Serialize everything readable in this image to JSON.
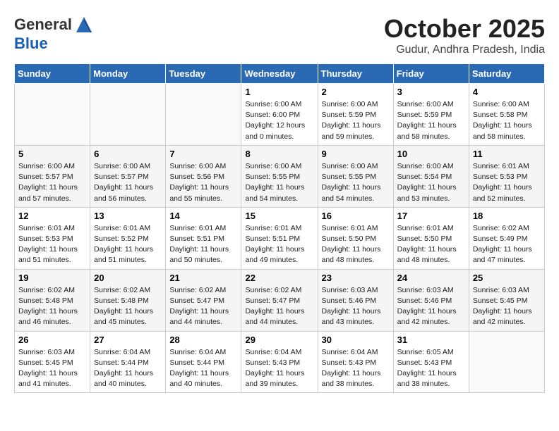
{
  "header": {
    "logo_line1": "General",
    "logo_line2": "Blue",
    "month": "October 2025",
    "location": "Gudur, Andhra Pradesh, India"
  },
  "weekdays": [
    "Sunday",
    "Monday",
    "Tuesday",
    "Wednesday",
    "Thursday",
    "Friday",
    "Saturday"
  ],
  "weeks": [
    [
      {
        "day": "",
        "info": ""
      },
      {
        "day": "",
        "info": ""
      },
      {
        "day": "",
        "info": ""
      },
      {
        "day": "1",
        "info": "Sunrise: 6:00 AM\nSunset: 6:00 PM\nDaylight: 12 hours\nand 0 minutes."
      },
      {
        "day": "2",
        "info": "Sunrise: 6:00 AM\nSunset: 5:59 PM\nDaylight: 11 hours\nand 59 minutes."
      },
      {
        "day": "3",
        "info": "Sunrise: 6:00 AM\nSunset: 5:59 PM\nDaylight: 11 hours\nand 58 minutes."
      },
      {
        "day": "4",
        "info": "Sunrise: 6:00 AM\nSunset: 5:58 PM\nDaylight: 11 hours\nand 58 minutes."
      }
    ],
    [
      {
        "day": "5",
        "info": "Sunrise: 6:00 AM\nSunset: 5:57 PM\nDaylight: 11 hours\nand 57 minutes."
      },
      {
        "day": "6",
        "info": "Sunrise: 6:00 AM\nSunset: 5:57 PM\nDaylight: 11 hours\nand 56 minutes."
      },
      {
        "day": "7",
        "info": "Sunrise: 6:00 AM\nSunset: 5:56 PM\nDaylight: 11 hours\nand 55 minutes."
      },
      {
        "day": "8",
        "info": "Sunrise: 6:00 AM\nSunset: 5:55 PM\nDaylight: 11 hours\nand 54 minutes."
      },
      {
        "day": "9",
        "info": "Sunrise: 6:00 AM\nSunset: 5:55 PM\nDaylight: 11 hours\nand 54 minutes."
      },
      {
        "day": "10",
        "info": "Sunrise: 6:00 AM\nSunset: 5:54 PM\nDaylight: 11 hours\nand 53 minutes."
      },
      {
        "day": "11",
        "info": "Sunrise: 6:01 AM\nSunset: 5:53 PM\nDaylight: 11 hours\nand 52 minutes."
      }
    ],
    [
      {
        "day": "12",
        "info": "Sunrise: 6:01 AM\nSunset: 5:53 PM\nDaylight: 11 hours\nand 51 minutes."
      },
      {
        "day": "13",
        "info": "Sunrise: 6:01 AM\nSunset: 5:52 PM\nDaylight: 11 hours\nand 51 minutes."
      },
      {
        "day": "14",
        "info": "Sunrise: 6:01 AM\nSunset: 5:51 PM\nDaylight: 11 hours\nand 50 minutes."
      },
      {
        "day": "15",
        "info": "Sunrise: 6:01 AM\nSunset: 5:51 PM\nDaylight: 11 hours\nand 49 minutes."
      },
      {
        "day": "16",
        "info": "Sunrise: 6:01 AM\nSunset: 5:50 PM\nDaylight: 11 hours\nand 48 minutes."
      },
      {
        "day": "17",
        "info": "Sunrise: 6:01 AM\nSunset: 5:50 PM\nDaylight: 11 hours\nand 48 minutes."
      },
      {
        "day": "18",
        "info": "Sunrise: 6:02 AM\nSunset: 5:49 PM\nDaylight: 11 hours\nand 47 minutes."
      }
    ],
    [
      {
        "day": "19",
        "info": "Sunrise: 6:02 AM\nSunset: 5:48 PM\nDaylight: 11 hours\nand 46 minutes."
      },
      {
        "day": "20",
        "info": "Sunrise: 6:02 AM\nSunset: 5:48 PM\nDaylight: 11 hours\nand 45 minutes."
      },
      {
        "day": "21",
        "info": "Sunrise: 6:02 AM\nSunset: 5:47 PM\nDaylight: 11 hours\nand 44 minutes."
      },
      {
        "day": "22",
        "info": "Sunrise: 6:02 AM\nSunset: 5:47 PM\nDaylight: 11 hours\nand 44 minutes."
      },
      {
        "day": "23",
        "info": "Sunrise: 6:03 AM\nSunset: 5:46 PM\nDaylight: 11 hours\nand 43 minutes."
      },
      {
        "day": "24",
        "info": "Sunrise: 6:03 AM\nSunset: 5:46 PM\nDaylight: 11 hours\nand 42 minutes."
      },
      {
        "day": "25",
        "info": "Sunrise: 6:03 AM\nSunset: 5:45 PM\nDaylight: 11 hours\nand 42 minutes."
      }
    ],
    [
      {
        "day": "26",
        "info": "Sunrise: 6:03 AM\nSunset: 5:45 PM\nDaylight: 11 hours\nand 41 minutes."
      },
      {
        "day": "27",
        "info": "Sunrise: 6:04 AM\nSunset: 5:44 PM\nDaylight: 11 hours\nand 40 minutes."
      },
      {
        "day": "28",
        "info": "Sunrise: 6:04 AM\nSunset: 5:44 PM\nDaylight: 11 hours\nand 40 minutes."
      },
      {
        "day": "29",
        "info": "Sunrise: 6:04 AM\nSunset: 5:43 PM\nDaylight: 11 hours\nand 39 minutes."
      },
      {
        "day": "30",
        "info": "Sunrise: 6:04 AM\nSunset: 5:43 PM\nDaylight: 11 hours\nand 38 minutes."
      },
      {
        "day": "31",
        "info": "Sunrise: 6:05 AM\nSunset: 5:43 PM\nDaylight: 11 hours\nand 38 minutes."
      },
      {
        "day": "",
        "info": ""
      }
    ]
  ]
}
